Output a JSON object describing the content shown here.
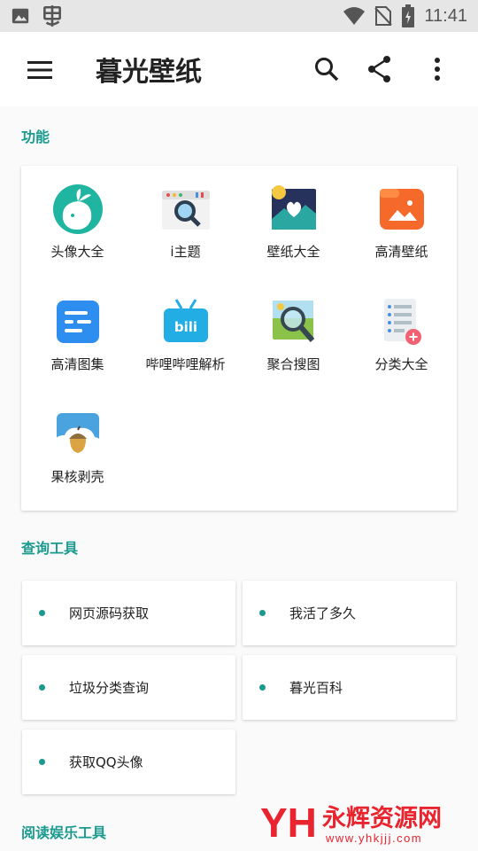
{
  "status_bar": {
    "time": "11:41",
    "icons": [
      "image-icon",
      "bug-icon",
      "wifi-icon",
      "no-sim-icon",
      "battery-charging-icon"
    ]
  },
  "app_bar": {
    "title": "暮光壁纸",
    "menu_icon": "hamburger-menu-icon",
    "actions": [
      "search-icon",
      "share-icon",
      "more-vertical-icon"
    ]
  },
  "sections": {
    "features": {
      "title": "功能",
      "items": [
        {
          "label": "头像大全",
          "icon": "avatar-app-icon"
        },
        {
          "label": "i主题",
          "icon": "theme-search-icon"
        },
        {
          "label": "壁纸大全",
          "icon": "wallpaper-heart-icon"
        },
        {
          "label": "高清壁纸",
          "icon": "hd-wallpaper-icon"
        },
        {
          "label": "高清图集",
          "icon": "gallery-icon"
        },
        {
          "label": "哔哩哔哩解析",
          "icon": "bilibili-icon"
        },
        {
          "label": "聚合搜图",
          "icon": "image-search-icon"
        },
        {
          "label": "分类大全",
          "icon": "category-list-icon"
        },
        {
          "label": "果核剥壳",
          "icon": "acorn-icon"
        }
      ]
    },
    "query_tools": {
      "title": "查询工具",
      "items": [
        {
          "label": "网页源码获取"
        },
        {
          "label": "我活了多久"
        },
        {
          "label": "垃圾分类查询"
        },
        {
          "label": "暮光百科"
        },
        {
          "label": "获取QQ头像"
        }
      ]
    },
    "reading_tools": {
      "title": "阅读娱乐工具"
    }
  },
  "watermark": {
    "logo": "YH",
    "name": "永辉资源网",
    "url": "www.yhkjjj.com"
  },
  "colors": {
    "accent": "#1a9a8e",
    "status_bar": "#e6e6e6",
    "watermark_red": "#e8242f"
  }
}
